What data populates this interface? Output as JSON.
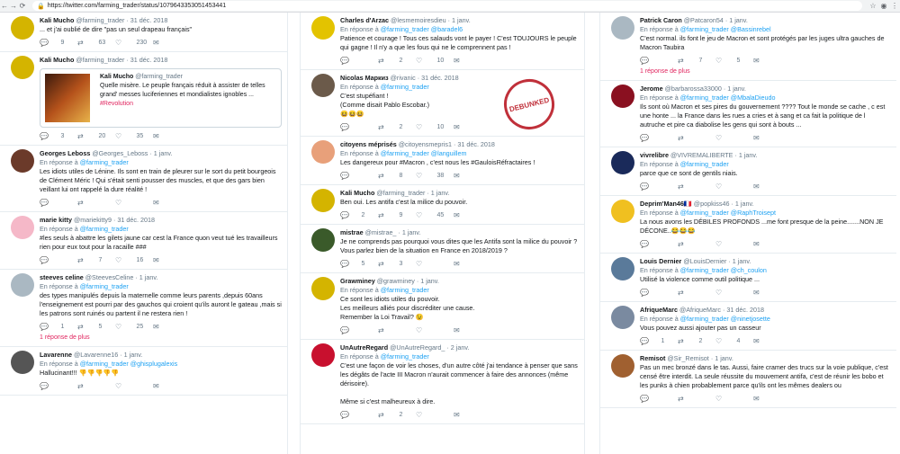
{
  "browser": {
    "url": "https://twitter.com/farming_trader/status/1079643353051453441"
  },
  "col1": [
    {
      "name": "Kali Mucho",
      "handle": "@farming_trader",
      "date": "· 31 déc. 2018",
      "reply": "",
      "text": "... et j'ai oublié de dire \"pas un seul drapeau français\"",
      "replies": "9",
      "rts": "63",
      "likes": "230",
      "color": "#d4b400",
      "more": ""
    },
    {
      "name": "Kali Mucho",
      "handle": "@farming_trader",
      "date": "· 31 déc. 2018",
      "reply": "",
      "text": "",
      "replies": "3",
      "rts": "20",
      "likes": "35",
      "color": "#d4b400",
      "more": "",
      "card": {
        "name": "Kali Mucho",
        "handle": "@farming_trader",
        "text": "Quelle misère. Le peuple français réduit à assister de telles grand' messes luciferiennes et mondialistes ignobles ...",
        "tag": "#Revolution"
      }
    },
    {
      "name": "Georges Leboss",
      "handle": "@Georges_Leboss",
      "date": "· 1 janv.",
      "reply": "@farming_trader",
      "text": "Les idiots utiles de Lénine. Ils sont en train de pleurer sur le sort du petit bourgeois de Clément Méric ! Qui s'était senti pousser des muscles, et que des gars bien veillant lui ont rappelé la dure réalité !",
      "replies": "",
      "rts": "",
      "likes": "",
      "color": "#6b3a2a",
      "more": ""
    },
    {
      "name": "marie kitty",
      "handle": "@mariekitty9",
      "date": "· 31 déc. 2018",
      "reply": "@farming_trader",
      "text": "#les seuls à abattre les gilets jaune car cest la France quon veut tué les travailleurs rien pour eux tout pour la racaille ###",
      "replies": "",
      "rts": "7",
      "likes": "16",
      "color": "#f5b8c8",
      "more": ""
    },
    {
      "name": "steeves celine",
      "handle": "@SteevesCeline",
      "date": "· 1 janv.",
      "reply": "@farming_trader",
      "text": "des types manipulés depuis la maternelle comme leurs parents ,depuis 60ans l'enseignement est pourri par des gauchos qui croient qu'ils auront le gateau ,mais si les patrons sont ruinés ou partent il ne restera rien !",
      "replies": "1",
      "rts": "5",
      "likes": "25",
      "color": "#aab8c2",
      "more": "1 réponse de plus"
    },
    {
      "name": "Lavarenne",
      "handle": "@Lavarenne16",
      "date": "· 1 janv.",
      "reply": "@farming_trader @ghisplugalexis",
      "text": "Hallucinant!!! 👎👎👎👎👎",
      "replies": "",
      "rts": "",
      "likes": "",
      "color": "#555",
      "more": ""
    }
  ],
  "col2": [
    {
      "name": "Charles d'Arzac",
      "handle": "@lesmemoiresdieu",
      "date": "· 1 janv.",
      "reply": "@farming_trader @baradel6",
      "text": "Patience et courage ! Tous ces salauds vont le payer ! C'est TOUJOURS le peuple qui gagne ! Il n'y a que les fous qui ne le comprennent pas !",
      "replies": "",
      "rts": "2",
      "likes": "10",
      "color": "#e3c300",
      "more": ""
    },
    {
      "name": "Nicolas Маркиз",
      "handle": "@rivanic",
      "date": "· 31 déc. 2018",
      "reply": "@farming_trader",
      "text": "C'est stupéfiant !\n(Comme disait Pablo Escobar.)\n😆😆😆",
      "replies": "",
      "rts": "2",
      "likes": "10",
      "color": "#6b5a4a",
      "more": ""
    },
    {
      "name": "citoyens méprisés",
      "handle": "@citoyensmepris1",
      "date": "· 31 déc. 2018",
      "reply": "@farming_trader @languillem",
      "text": "Les dangereux pour #Macron , c'est nous les #GauloisRéfractaires !",
      "replies": "",
      "rts": "8",
      "likes": "38",
      "color": "#e8a07a",
      "more": ""
    },
    {
      "name": "Kali Mucho",
      "handle": "@farming_trader",
      "date": "· 1 janv.",
      "reply": "",
      "text": "Ben oui. Les antifa c'est la milice du pouvoir.",
      "replies": "2",
      "rts": "9",
      "likes": "45",
      "color": "#d4b400",
      "more": ""
    },
    {
      "name": "mistrae",
      "handle": "@mistrae_",
      "date": "· 1 janv.",
      "reply": "",
      "text": "Je ne comprends pas pourquoi vous dites que les Antifa sont la milice du pouvoir ? Vous parlez bien de la situation en France en 2018/2019 ?",
      "replies": "5",
      "rts": "3",
      "likes": "",
      "color": "#3a5a2a",
      "more": ""
    },
    {
      "name": "Grawminey",
      "handle": "@grawminey",
      "date": "· 1 janv.",
      "reply": "@farming_trader",
      "text": "Ce sont les idiots utiles du pouvoir.\nLes meilleurs alliés pour discréditer une cause.\nRemember la Loi Travail? 😉",
      "replies": "",
      "rts": "",
      "likes": "",
      "color": "#d4b400",
      "more": ""
    },
    {
      "name": "UnAutreRegard",
      "handle": "@UnAutreRegard_",
      "date": "· 2 janv.",
      "reply": "@farming_trader",
      "text": "C'est une façon de voir les choses, d'un autre côté j'ai tendance à penser que sans les dégâts de l'acte III Macron n'aurait commencer à faire des annonces (même dérisoire).\n\nMême si c'est malheureux à dire.",
      "replies": "",
      "rts": "2",
      "likes": "",
      "color": "#c8102e",
      "more": ""
    }
  ],
  "col3": [
    {
      "name": "Patrick Caron",
      "handle": "@Patcaron54",
      "date": "· 1 janv.",
      "reply": "@farming_trader @Bassinrebel",
      "text": "C'est normal. ils font le jeu de Macron et sont protégés par les juges ultra gauches de Macron Taubira",
      "replies": "",
      "rts": "7",
      "likes": "5",
      "color": "#aab8c2",
      "more": "1 réponse de plus"
    },
    {
      "name": "Jerome",
      "handle": "@barbarossa33000",
      "date": "· 1 janv.",
      "reply": "@farming_trader @MbalaDieudo",
      "text": "Ils sont où Macron et ses pires du gouvernement ???? Tout le monde se cache , c est une honte ... la France dans les rues a cries et à sang et ca fait la politique de l autruche et pire ca diabolise les gens qui sont à bouts ...",
      "replies": "",
      "rts": "",
      "likes": "",
      "color": "#8a1020",
      "more": ""
    },
    {
      "name": "vivrelibre",
      "handle": "@VIVREMALIBERTE",
      "date": "· 1 janv.",
      "reply": "@farming_trader",
      "text": "parce que ce sont de gentils niais.",
      "replies": "",
      "rts": "",
      "likes": "",
      "color": "#1a2a5a",
      "more": ""
    },
    {
      "name": "Deprim'Man46🇫🇷",
      "handle": "@popkiss46",
      "date": "· 1 janv.",
      "reply": "@farming_trader @RaphTroisept",
      "text": "La nous avons les DÉBILES PROFONDS ...me font presque de la peine.......NON JE DÉCONE..😂😂😂",
      "replies": "",
      "rts": "",
      "likes": "",
      "color": "#f0c020",
      "more": ""
    },
    {
      "name": "Louis Dernier",
      "handle": "@LouisDernier",
      "date": "· 1 janv.",
      "reply": "@farming_trader @ch_coulon",
      "text": "Utilisé la violence comme outil politique ...",
      "replies": "",
      "rts": "",
      "likes": "",
      "color": "#5a7a9a",
      "more": ""
    },
    {
      "name": "AfriqueMarc",
      "handle": "@AfriqueMarc",
      "date": "· 31 déc. 2018",
      "reply": "@farming_trader @ninetjosette",
      "text": "Vous pouvez aussi ajouter pas un casseur",
      "replies": "1",
      "rts": "2",
      "likes": "4",
      "color": "#7a8aa0",
      "more": ""
    },
    {
      "name": "Remisot",
      "handle": "@Sir_Remisot",
      "date": "· 1 janv.",
      "reply": "",
      "text": "Pas un mec bronzé dans le tas. Aussi, faire cramer des trucs sur la voie publique, c'est censé être interdit. La seule réussite du mouvement antifa, c'est de réunir les bobo et les punks à chien probablement parce qu'ils ont les mêmes dealers ou",
      "replies": "",
      "rts": "",
      "likes": "",
      "color": "#a06030",
      "more": ""
    }
  ],
  "labels": {
    "reply_prefix": "En réponse à",
    "stamp": "DEBUNKED"
  }
}
